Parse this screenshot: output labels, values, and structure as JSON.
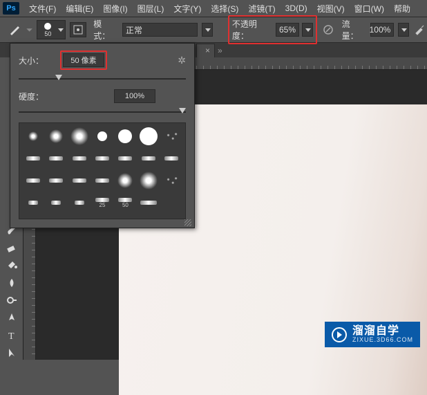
{
  "menu": [
    "文件(F)",
    "编辑(E)",
    "图像(I)",
    "图层(L)",
    "文字(Y)",
    "选择(S)",
    "滤镜(T)",
    "3D(D)",
    "视图(V)",
    "窗口(W)",
    "帮助"
  ],
  "options": {
    "brush_size_thumb": "50",
    "mode_label": "模式：",
    "mode_value": "正常",
    "opacity_label": "不透明度：",
    "opacity_value": "65%",
    "flow_label": "流量：",
    "flow_value": "100%"
  },
  "tab": {
    "name": "",
    "close": "×"
  },
  "brush_popup": {
    "size_label": "大小：",
    "size_value": "50 像素",
    "hardness_label": "硬度：",
    "hardness_value": "100%",
    "grid_labels": {
      "b25": "25",
      "b50": "50"
    }
  },
  "watermark": {
    "main": "溜溜自学",
    "sub": "ZIXUE.3D66.COM"
  }
}
